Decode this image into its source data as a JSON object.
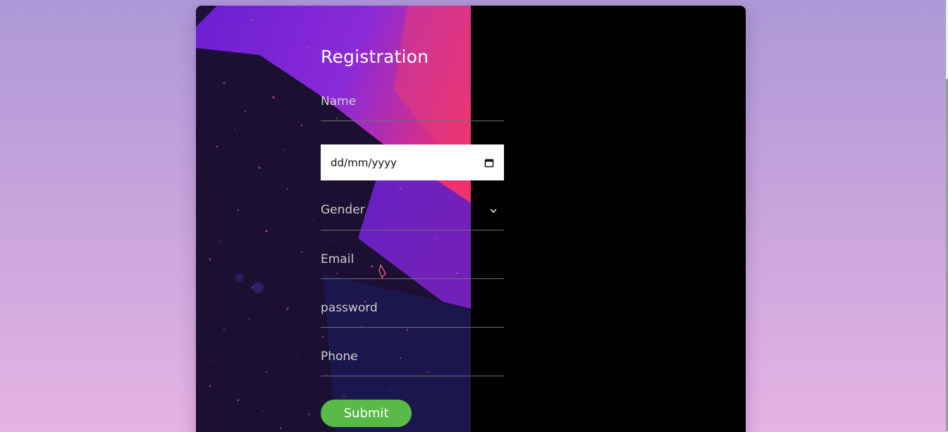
{
  "form": {
    "title": "Registration",
    "name_placeholder": "Name",
    "date_placeholder": "dd/mm/yyyy",
    "gender_placeholder": "Gender",
    "email_placeholder": "Email",
    "password_placeholder": "password",
    "phone_placeholder": "Phone",
    "submit_label": "Submit"
  },
  "icons": {
    "date": "calendar-icon",
    "gender": "chevron-down-icon"
  },
  "colors": {
    "panel": "#000000",
    "submit": "#5aba47",
    "page_gradient_top": "#ae98d8",
    "page_gradient_bottom": "#e6b3e4"
  }
}
